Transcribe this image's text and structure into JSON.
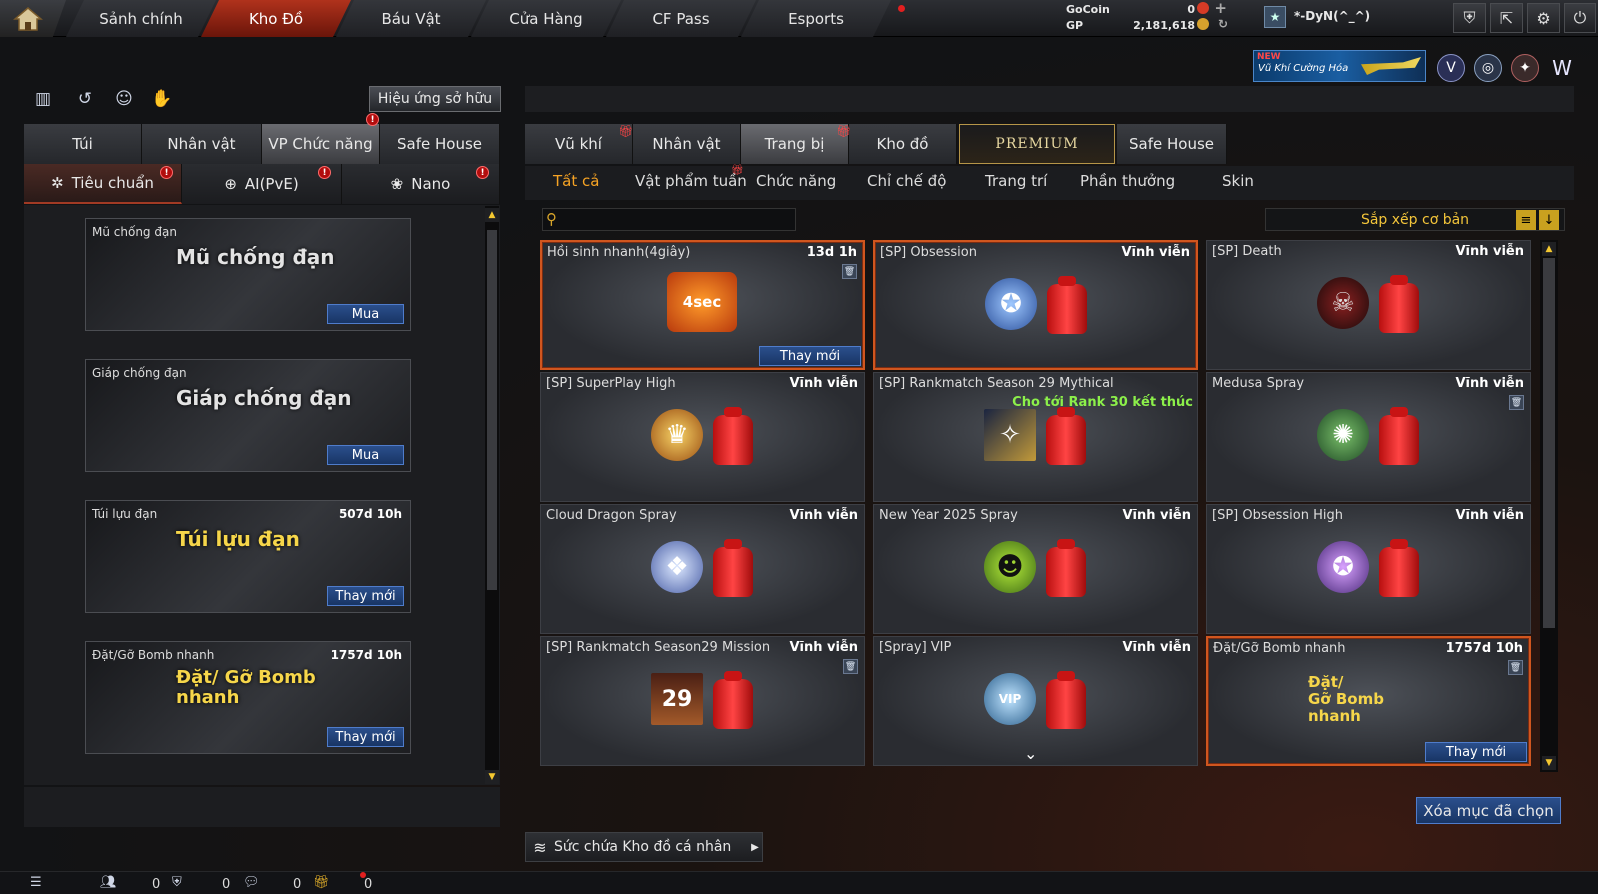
{
  "topnav": {
    "tabs": [
      "Sảnh chính",
      "Kho Đồ",
      "Báu Vật",
      "Cửa Hàng",
      "CF Pass",
      "Esports"
    ],
    "active": "Kho Đồ"
  },
  "currency": {
    "gocoin_label": "GoCoin",
    "gocoin_value": "0",
    "gp_label": "GP",
    "gp_value": "2,181,618"
  },
  "user": {
    "name": "*-DyN(^_^)"
  },
  "promo": {
    "badge": "NEW",
    "text": "Vũ Khí Cường Hóa"
  },
  "left": {
    "effect_button": "Hiệu ứng sở hữu",
    "tabs": [
      "Túi",
      "Nhân vật",
      "VP Chức năng",
      "Safe House"
    ],
    "active_tab": "VP Chức năng",
    "subtabs": [
      "Tiêu chuẩn",
      "AI(PvE)",
      "Nano"
    ],
    "items": [
      {
        "name": "Mũ chống đạn",
        "time": "",
        "art": "Mũ chống đạn",
        "button": "Mua"
      },
      {
        "name": "Giáp chống đạn",
        "time": "",
        "art": "Giáp chống đạn",
        "button": "Mua"
      },
      {
        "name": "Túi lựu đạn",
        "time": "507d 10h",
        "art": "Túi lựu đạn",
        "button": "Thay mới"
      },
      {
        "name": "Đặt/Gỡ Bomb nhanh",
        "time": "1757d 10h",
        "art": "Đặt/ Gỡ Bomb nhanh",
        "button": "Thay mới"
      }
    ]
  },
  "right": {
    "tabs": [
      "Vũ khí",
      "Nhân vật",
      "Trang bị",
      "Kho đồ",
      "PREMIUM",
      "Safe House"
    ],
    "active_tab": "Trang bị",
    "subcategories": [
      "Tất cả",
      "Vật phẩm tuần",
      "Chức năng",
      "Chỉ chế độ",
      "Trang trí",
      "Phần thưởng",
      "Skin"
    ],
    "active_subcategory": "Tất cả",
    "sort_label": "Sắp xếp cơ bản",
    "items": [
      {
        "name": "Hồi sinh nhanh(4giây)",
        "time": "13d 1h",
        "sub": "",
        "button": "Thay mới",
        "art": "4sec",
        "highlight": true
      },
      {
        "name": "[SP] Obsession",
        "time": "Vĩnh viễn",
        "sub": "",
        "button": "",
        "art": "obsession",
        "highlight": true
      },
      {
        "name": "[SP] Death",
        "time": "Vĩnh viễn",
        "sub": "",
        "button": "",
        "art": "death",
        "highlight": false
      },
      {
        "name": "[SP] SuperPlay High",
        "time": "Vĩnh viễn",
        "sub": "",
        "button": "",
        "art": "superplay",
        "highlight": false
      },
      {
        "name": "[SP] Rankmatch Season 29 Mythical",
        "time": "",
        "sub": "Cho tới Rank 30 kết thúc",
        "button": "",
        "art": "mythical",
        "highlight": false
      },
      {
        "name": "Medusa Spray",
        "time": "Vĩnh viễn",
        "sub": "",
        "button": "",
        "art": "medusa",
        "highlight": false
      },
      {
        "name": "Cloud Dragon Spray",
        "time": "Vĩnh viễn",
        "sub": "",
        "button": "",
        "art": "dragon",
        "highlight": false
      },
      {
        "name": "New Year 2025 Spray",
        "time": "Vĩnh viễn",
        "sub": "",
        "button": "",
        "art": "newyear",
        "highlight": false
      },
      {
        "name": "[SP] Obsession High",
        "time": "Vĩnh viễn",
        "sub": "",
        "button": "",
        "art": "obsession-high",
        "highlight": false
      },
      {
        "name": "[SP] Rankmatch Season29 Mission",
        "time": "Vĩnh viễn",
        "sub": "",
        "button": "",
        "art": "29",
        "highlight": false
      },
      {
        "name": "[Spray] VIP",
        "time": "Vĩnh viễn",
        "sub": "",
        "button": "",
        "art": "VIP",
        "highlight": false
      },
      {
        "name": "Đặt/Gỡ Bomb nhanh",
        "time": "1757d 10h",
        "sub": "",
        "button": "Thay mới",
        "art": "bomb",
        "highlight": true
      }
    ],
    "delete_button": "Xóa mục đã chọn",
    "capacity_button": "Sức chứa Kho đồ cá nhân"
  },
  "status_bar": {
    "friends": "0",
    "clan": "0",
    "messages": "0",
    "gifts": "0"
  }
}
